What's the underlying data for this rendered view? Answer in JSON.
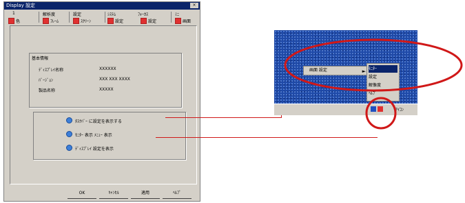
{
  "dialog": {
    "title": "Display 設定",
    "close_label": "×",
    "tabs": [
      {
        "top": "1",
        "bottom": "色"
      },
      {
        "top": "解析度",
        "bottom": "ﾌﾚｰﾑ"
      },
      {
        "top": "設定",
        "bottom": "ｽｸﾘｰﾝ"
      },
      {
        "top": "ｼｽﾃﾑ",
        "bottom": "設定"
      },
      {
        "top": "ﾌｫｰｶｽ",
        "bottom": "設定"
      },
      {
        "top": "ﾐﾆ",
        "bottom": "画面"
      }
    ],
    "info": {
      "title": "基本情報",
      "rows": [
        {
          "label": "ﾃﾞｨｽﾌﾟﾚｲ名称",
          "value": "XXXXXX"
        },
        {
          "label": "ﾊﾞｰｼﾞｮﾝ",
          "value": "XXX XXX XXXX"
        },
        {
          "label": "製品名称",
          "value": "XXXXX"
        }
      ]
    },
    "options": [
      "ﾀｽｸﾊﾞｰ に設定を表示する",
      "ﾓﾆﾀｰ 表示 ﾒﾆｭｰ 表示",
      "ﾃﾞｨｽﾌﾟﾚｲ 設定を表示"
    ],
    "buttons": [
      "OK",
      "ｷｬﾝｾﾙ",
      "適用",
      "ﾍﾙﾌﾟ"
    ]
  },
  "tray_popup": {
    "menu_left": "画面 設定",
    "submenu": [
      "ﾓﾆﾀｰ",
      "設定",
      "解像度",
      "ﾍﾙﾌﾟ"
    ],
    "tray_text": "ｱｲｺﾝ"
  },
  "colors": {
    "accent": "#d01818",
    "desktop": "#1f4aa8",
    "window": "#d4d0c8",
    "titlebar": "#0a246a"
  }
}
